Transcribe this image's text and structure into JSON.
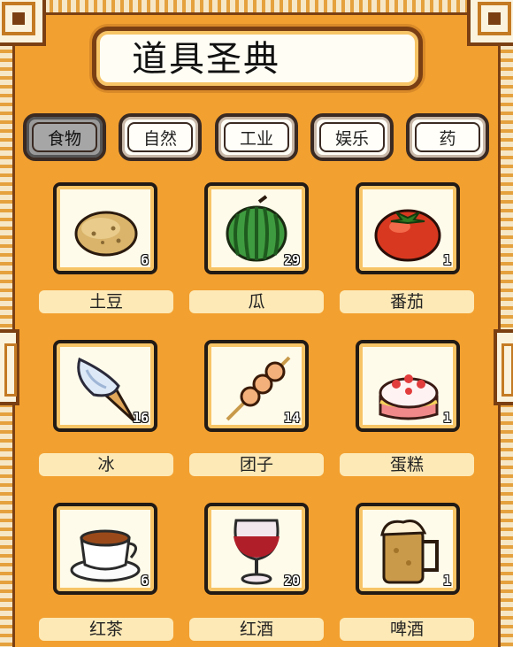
{
  "title": "道具圣典",
  "tabs": [
    {
      "label": "食物",
      "active": true
    },
    {
      "label": "自然",
      "active": false
    },
    {
      "label": "工业",
      "active": false
    },
    {
      "label": "娱乐",
      "active": false
    },
    {
      "label": "药",
      "active": false
    }
  ],
  "items": [
    {
      "name": "土豆",
      "count": "6",
      "icon": "potato-icon"
    },
    {
      "name": "瓜",
      "count": "29",
      "icon": "watermelon-icon"
    },
    {
      "name": "番茄",
      "count": "1",
      "icon": "tomato-icon"
    },
    {
      "name": "冰",
      "count": "16",
      "icon": "ice-cream-icon"
    },
    {
      "name": "团子",
      "count": "14",
      "icon": "dango-icon"
    },
    {
      "name": "蛋糕",
      "count": "1",
      "icon": "cake-icon"
    },
    {
      "name": "红茶",
      "count": "6",
      "icon": "tea-cup-icon"
    },
    {
      "name": "红酒",
      "count": "20",
      "icon": "wine-glass-icon"
    },
    {
      "name": "啤酒",
      "count": "1",
      "icon": "beer-mug-icon"
    }
  ],
  "colors": {
    "background": "#f2a030",
    "frame": "#7a3f12",
    "label_bg": "#fde9b6"
  }
}
